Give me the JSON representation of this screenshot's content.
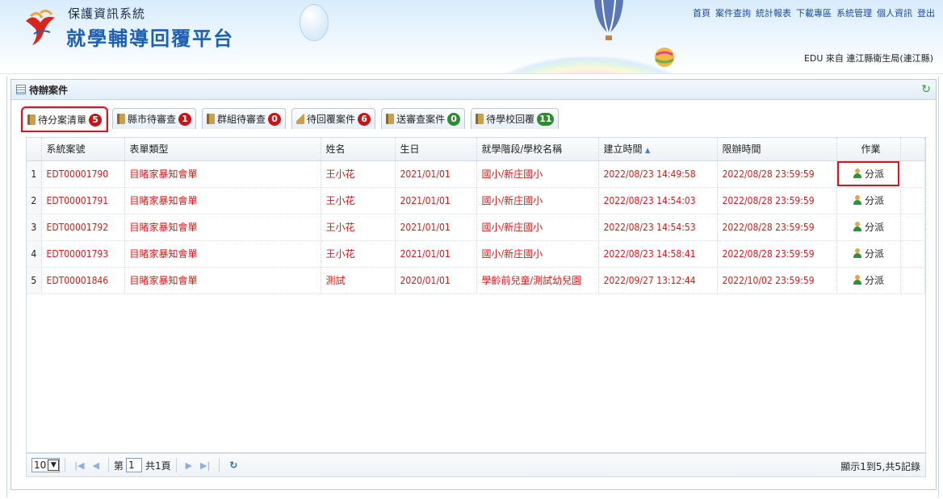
{
  "header": {
    "system_name": "保護資訊系統",
    "platform_name": "就學輔導回覆平台",
    "nav_items": [
      "首頁",
      "案件查詢",
      "統計報表",
      "下載專區",
      "系統管理",
      "個人資訊",
      "登出"
    ],
    "user_info": "EDU 來自 連江縣衛生局(連江縣)"
  },
  "panel": {
    "title": "待辦案件"
  },
  "tabs": [
    {
      "label": "待分案清單",
      "count": "5",
      "color": "#c4151b"
    },
    {
      "label": "縣市待審查",
      "count": "1",
      "color": "#c4151b"
    },
    {
      "label": "群組待審查",
      "count": "0",
      "color": "#c4151b"
    },
    {
      "label": "待回覆案件",
      "count": "6",
      "color": "#c4151b"
    },
    {
      "label": "送審查案件",
      "count": "0",
      "color": "#2e8b2e"
    },
    {
      "label": "待學校回覆",
      "count": "11",
      "color": "#2e8b2e"
    }
  ],
  "table": {
    "columns": [
      "系統案號",
      "表單類型",
      "姓名",
      "生日",
      "就學階段/學校名稱",
      "建立時間",
      "限辦時間",
      "作業"
    ],
    "rows": [
      {
        "num": "1",
        "case_id": "EDT00001790",
        "form": "目睹家暴知會單",
        "name": "王小花",
        "birthday": "2021/01/01",
        "school": "國小/新庄國小",
        "created": "2022/08/23 14:49:58",
        "deadline": "2022/08/28 23:59:59",
        "action": "分派"
      },
      {
        "num": "2",
        "case_id": "EDT00001791",
        "form": "目睹家暴知會單",
        "name": "王小花",
        "birthday": "2021/01/01",
        "school": "國小/新庄國小",
        "created": "2022/08/23 14:54:03",
        "deadline": "2022/08/28 23:59:59",
        "action": "分派"
      },
      {
        "num": "3",
        "case_id": "EDT00001792",
        "form": "目睹家暴知會單",
        "name": "王小花",
        "birthday": "2021/01/01",
        "school": "國小/新庄國小",
        "created": "2022/08/23 14:54:53",
        "deadline": "2022/08/28 23:59:59",
        "action": "分派"
      },
      {
        "num": "4",
        "case_id": "EDT00001793",
        "form": "目睹家暴知會單",
        "name": "王小花",
        "birthday": "2021/01/01",
        "school": "國小/新庄國小",
        "created": "2022/08/23 14:58:41",
        "deadline": "2022/08/28 23:59:59",
        "action": "分派"
      },
      {
        "num": "5",
        "case_id": "EDT00001846",
        "form": "目睹家暴知會單",
        "name": "測試",
        "birthday": "2020/01/01",
        "school": "學齡前兒童/測試幼兒園",
        "created": "2022/09/27 13:12:44",
        "deadline": "2022/10/02 23:59:59",
        "action": "分派"
      }
    ],
    "row_text_color": "#d41b1b"
  },
  "pager": {
    "page_size": "10",
    "page_prefix": "第",
    "current_page": "1",
    "total_pages": "共1頁",
    "info": "顯示1到5,共5記錄"
  },
  "colors": {
    "highlight": "#e0121b",
    "brand_blue": "#1d5fb0"
  }
}
